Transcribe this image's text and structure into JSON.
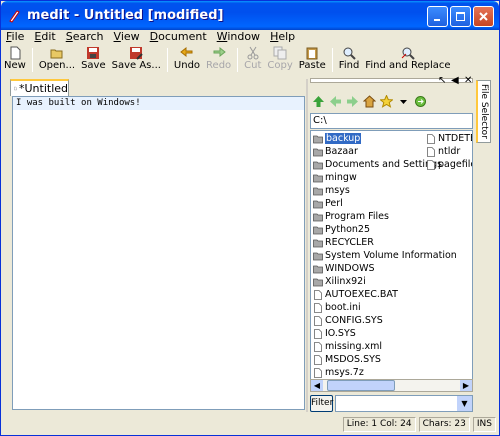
{
  "window": {
    "title": "medit - Untitled [modified]",
    "colors": {
      "titlebar": "#0055ea",
      "selection": "#316ac5",
      "current_line": "#e8f2fe"
    }
  },
  "menu": [
    {
      "label": "File",
      "accel": "F",
      "rest": "ile"
    },
    {
      "label": "Edit",
      "accel": "E",
      "rest": "dit"
    },
    {
      "label": "Search",
      "accel": "S",
      "rest": "earch"
    },
    {
      "label": "View",
      "accel": "V",
      "rest": "iew"
    },
    {
      "label": "Document",
      "accel": "D",
      "rest": "ocument"
    },
    {
      "label": "Window",
      "accel": "W",
      "rest": "indow"
    },
    {
      "label": "Help",
      "accel": "H",
      "rest": "elp"
    }
  ],
  "toolbar": {
    "new": "New",
    "open": "Open...",
    "save": "Save",
    "save_as": "Save As...",
    "undo": "Undo",
    "redo": "Redo",
    "cut": "Cut",
    "copy": "Copy",
    "paste": "Paste",
    "find": "Find",
    "find_replace": "Find and Replace"
  },
  "document": {
    "tab_label": "*Untitled",
    "text": "I was built on Windows!"
  },
  "file_selector": {
    "side_tab_label": "File Selector",
    "path": "C:\\",
    "filter_label": "Filter",
    "filter_value": "",
    "column1": [
      {
        "name": "backup",
        "type": "folder",
        "selected": true
      },
      {
        "name": "Bazaar",
        "type": "folder"
      },
      {
        "name": "Documents and Settings",
        "type": "folder"
      },
      {
        "name": "mingw",
        "type": "folder"
      },
      {
        "name": "msys",
        "type": "folder"
      },
      {
        "name": "Perl",
        "type": "folder"
      },
      {
        "name": "Program Files",
        "type": "folder"
      },
      {
        "name": "Python25",
        "type": "folder"
      },
      {
        "name": "RECYCLER",
        "type": "folder"
      },
      {
        "name": "System Volume Information",
        "type": "folder"
      },
      {
        "name": "WINDOWS",
        "type": "folder"
      },
      {
        "name": "Xilinx92i",
        "type": "folder"
      },
      {
        "name": "AUTOEXEC.BAT",
        "type": "file"
      },
      {
        "name": "boot.ini",
        "type": "file"
      },
      {
        "name": "CONFIG.SYS",
        "type": "file"
      },
      {
        "name": "IO.SYS",
        "type": "file"
      },
      {
        "name": "missing.xml",
        "type": "file"
      },
      {
        "name": "MSDOS.SYS",
        "type": "file"
      },
      {
        "name": "msys.7z",
        "type": "file"
      }
    ],
    "column2": [
      {
        "name": "NTDETECT",
        "type": "file"
      },
      {
        "name": "ntldr",
        "type": "file"
      },
      {
        "name": "pagefile.s",
        "type": "file"
      }
    ]
  },
  "status": {
    "position": "Line: 1 Col: 24",
    "chars": "Chars: 23",
    "mode": "INS"
  }
}
